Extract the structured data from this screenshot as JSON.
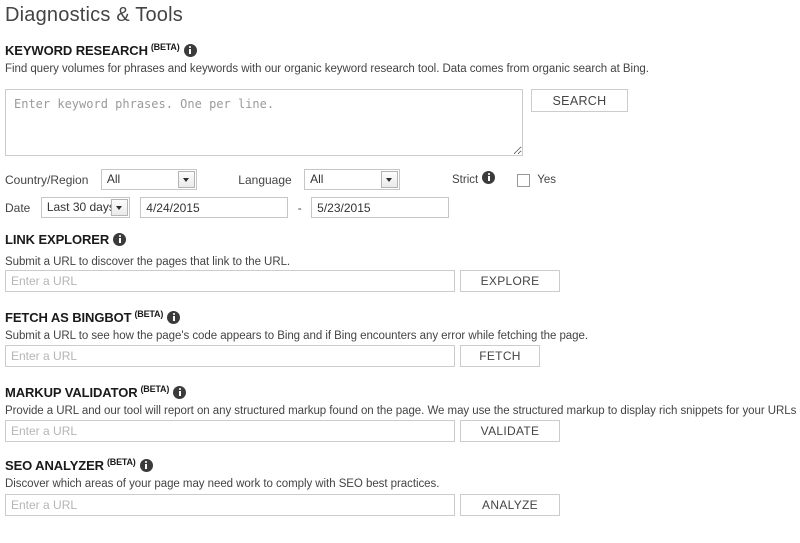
{
  "page": {
    "title": "Diagnostics & Tools"
  },
  "icons": {
    "info": "info-icon",
    "dropdown_arrow": "chevron-down-icon",
    "checkbox": "checkbox-icon"
  },
  "beta_label": "(BETA)",
  "sections": {
    "keyword_research": {
      "title": "KEYWORD RESEARCH",
      "has_beta": true,
      "description": "Find query volumes for phrases and keywords with our organic keyword research tool. Data comes from organic search at Bing.",
      "textarea_placeholder": "Enter keyword phrases. One per line.",
      "textarea_value": "",
      "search_button": "SEARCH",
      "filters": {
        "country_label": "Country/Region",
        "country_value": "All",
        "language_label": "Language",
        "language_value": "All",
        "strict_label": "Strict",
        "strict_checked": false,
        "yes_label": "Yes",
        "date_label": "Date",
        "date_range_value": "Last 30 days",
        "date_from": "4/24/2015",
        "date_separator": "-",
        "date_to": "5/23/2015"
      }
    },
    "link_explorer": {
      "title": "LINK EXPLORER",
      "has_beta": false,
      "description": "Submit a URL to discover the pages that link to the URL.",
      "input_placeholder": "Enter a URL",
      "input_value": "",
      "button": "EXPLORE"
    },
    "fetch_as_bingbot": {
      "title": "FETCH AS BINGBOT",
      "has_beta": true,
      "description": "Submit a URL to see how the page's code appears to Bing and if Bing encounters any error while fetching the page.",
      "input_placeholder": "Enter a URL",
      "input_value": "",
      "button": "FETCH"
    },
    "markup_validator": {
      "title": "MARKUP VALIDATOR",
      "has_beta": true,
      "description": "Provide a URL and our tool will report on any structured markup found on the page. We may use the structured markup to display rich snippets for your URLs in Bing.",
      "input_placeholder": "Enter a URL",
      "input_value": "",
      "button": "VALIDATE"
    },
    "seo_analyzer": {
      "title": "SEO ANALYZER",
      "has_beta": true,
      "description": "Discover which areas of your page may need work to comply with SEO best practices.",
      "input_placeholder": "Enter a URL",
      "input_value": "",
      "button": "ANALYZE"
    }
  },
  "colors": {
    "page_background": "#ffffff",
    "title_text": "#444444",
    "heading_text": "#1a1a1a",
    "body_text": "#444444",
    "border": "#cccccc",
    "placeholder": "#b5b5b5",
    "info_icon": "#3b3b3b"
  }
}
